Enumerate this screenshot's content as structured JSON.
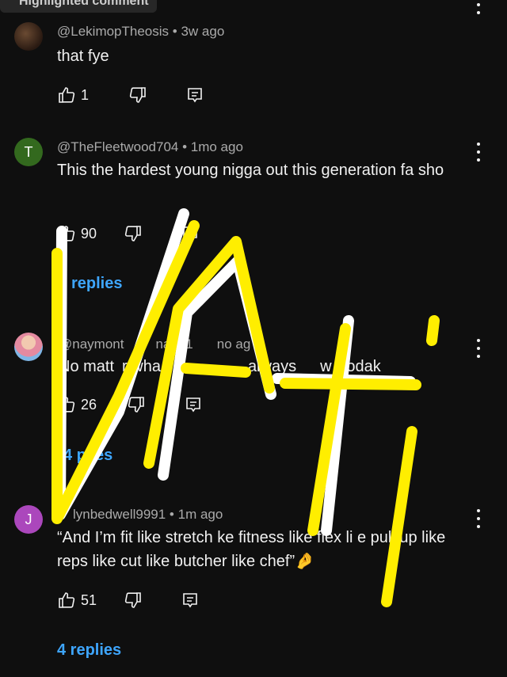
{
  "highlight_badge": "Highlighted comment",
  "comments": [
    {
      "author": "@LekimopTheosis",
      "age": "3w ago",
      "text": "that fye",
      "likes": "1",
      "avatar_letter": "",
      "avatar_color": "#3a2a1f",
      "replies": ""
    },
    {
      "author": "@TheFleetwood704",
      "age": "1mo ago",
      "text": "This the hardest young nigga out this generation fa sho",
      "likes": "90",
      "avatar_letter": "T",
      "avatar_color": "#33691e",
      "replies": "replies"
    },
    {
      "author": "@naymont​na731",
      "age": "no ag",
      "text": "No matt r wha always w Kodak",
      "likes": "26",
      "avatar_letter": "",
      "avatar_color": "#e8a0a8",
      "replies": "4 plies"
    },
    {
      "author": "lynbedwell9991",
      "age": "1m ago",
      "text": "“And I’m fit like stretch ke fitness like flex li e pull up like reps like cut like butcher like chef”🤌",
      "likes": "51",
      "avatar_letter": "J",
      "avatar_color": "#ab47bc",
      "replies": "4 replies"
    }
  ],
  "overlay_text": "VAti",
  "colors": {
    "background": "#0f0f0f",
    "link": "#3ea6ff",
    "overlay_yellow": "#ffee00",
    "overlay_white": "#ffffff"
  },
  "icons": [
    "like-icon",
    "dislike-icon",
    "reply-icon",
    "more-vertical-icon"
  ]
}
